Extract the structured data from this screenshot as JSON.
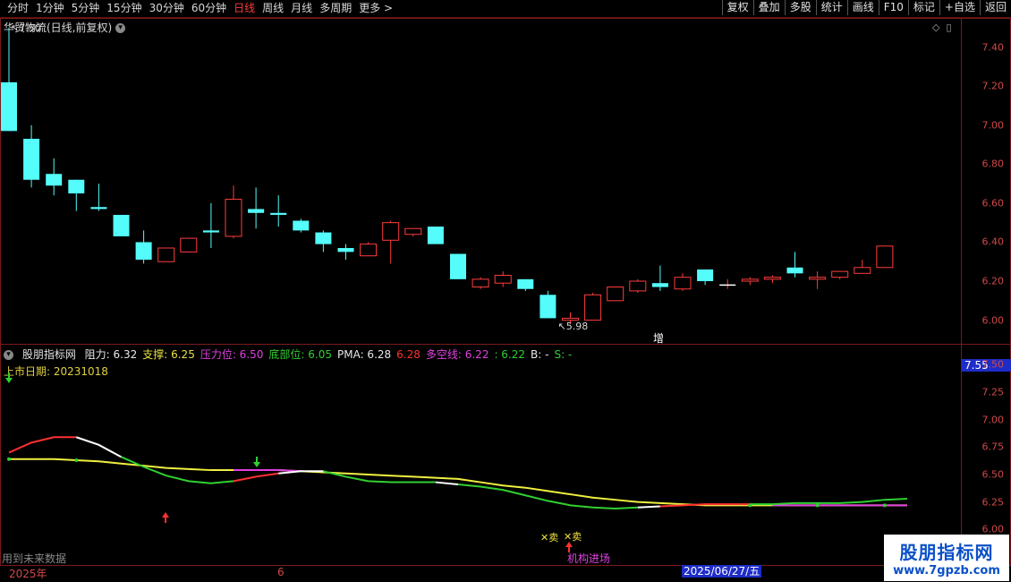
{
  "toolbar": {
    "periods": [
      "分时",
      "1分钟",
      "5分钟",
      "15分钟",
      "30分钟",
      "60分钟",
      "日线",
      "周线",
      "月线",
      "多周期",
      "更多 >"
    ],
    "active": "日线",
    "buttons": [
      "复权",
      "叠加",
      "多股",
      "统计",
      "画线",
      "F10",
      "标记",
      "+自选",
      "返回"
    ]
  },
  "stock": {
    "title": "华贸物流(日线,前复权)",
    "high_label": "7.50",
    "low_label": "5.98",
    "marker": "增"
  },
  "price_axis": [
    "7.40",
    "7.20",
    "7.00",
    "6.80",
    "6.60",
    "6.40",
    "6.20",
    "6.00"
  ],
  "indicator": {
    "name": "股朋指标网",
    "items": [
      {
        "text": "阻力: 6.32",
        "color": "#e8e8e8"
      },
      {
        "text": "支撑: 6.25",
        "color": "#e8e040"
      },
      {
        "text": "压力位: 6.50",
        "color": "#e040e0"
      },
      {
        "text": "底部位: 6.05",
        "color": "#30d030"
      },
      {
        "text": "PMA: 6.28",
        "color": "#e8e8e8"
      },
      {
        "text": "6.28",
        "color": "#ff3030"
      },
      {
        "text": "多空线: 6.22",
        "color": "#e040e0"
      },
      {
        "text": ": 6.22",
        "color": "#30d030"
      },
      {
        "text": "B: -",
        "color": "#e8e8e8"
      },
      {
        "text": "S: -",
        "color": "#30d030"
      }
    ],
    "list_date": "上市日期: 20231018",
    "future_text": "用到未来数据",
    "axis_highlight": "7.55",
    "axis": [
      "7.50",
      "7.25",
      "7.00",
      "6.75",
      "6.50",
      "6.25",
      "6.00"
    ],
    "sell_label": "卖",
    "inst_label": "机构进场"
  },
  "dates": {
    "year": "2025年",
    "month": "6",
    "highlight": "2025/06/27/五"
  },
  "watermark": {
    "title": "股朋指标网",
    "url": "www.7gpzb.com"
  },
  "chart_data": {
    "type": "candlestick",
    "title": "华贸物流(日线,前复权)",
    "candles": [
      {
        "o": 7.22,
        "h": 7.5,
        "l": 6.97,
        "c": 6.97
      },
      {
        "o": 6.93,
        "h": 7.0,
        "l": 6.68,
        "c": 6.72
      },
      {
        "o": 6.75,
        "h": 6.83,
        "l": 6.64,
        "c": 6.69
      },
      {
        "o": 6.72,
        "h": 6.72,
        "l": 6.56,
        "c": 6.65
      },
      {
        "o": 6.58,
        "h": 6.7,
        "l": 6.56,
        "c": 6.57
      },
      {
        "o": 6.54,
        "h": 6.54,
        "l": 6.43,
        "c": 6.43
      },
      {
        "o": 6.4,
        "h": 6.46,
        "l": 6.29,
        "c": 6.31
      },
      {
        "o": 6.3,
        "h": 6.37,
        "l": 6.3,
        "c": 6.37
      },
      {
        "o": 6.35,
        "h": 6.42,
        "l": 6.35,
        "c": 6.42
      },
      {
        "o": 6.46,
        "h": 6.6,
        "l": 6.37,
        "c": 6.45
      },
      {
        "o": 6.43,
        "h": 6.69,
        "l": 6.42,
        "c": 6.62
      },
      {
        "o": 6.57,
        "h": 6.68,
        "l": 6.47,
        "c": 6.55
      },
      {
        "o": 6.55,
        "h": 6.64,
        "l": 6.48,
        "c": 6.54
      },
      {
        "o": 6.51,
        "h": 6.52,
        "l": 6.45,
        "c": 6.46
      },
      {
        "o": 6.45,
        "h": 6.46,
        "l": 6.35,
        "c": 6.39
      },
      {
        "o": 6.37,
        "h": 6.39,
        "l": 6.31,
        "c": 6.35
      },
      {
        "o": 6.33,
        "h": 6.4,
        "l": 6.33,
        "c": 6.39
      },
      {
        "o": 6.41,
        "h": 6.51,
        "l": 6.29,
        "c": 6.5
      },
      {
        "o": 6.44,
        "h": 6.47,
        "l": 6.43,
        "c": 6.47
      },
      {
        "o": 6.48,
        "h": 6.48,
        "l": 6.4,
        "c": 6.39
      },
      {
        "o": 6.34,
        "h": 6.34,
        "l": 6.21,
        "c": 6.21
      },
      {
        "o": 6.17,
        "h": 6.22,
        "l": 6.16,
        "c": 6.21
      },
      {
        "o": 6.19,
        "h": 6.25,
        "l": 6.17,
        "c": 6.23
      },
      {
        "o": 6.21,
        "h": 6.21,
        "l": 6.15,
        "c": 6.16
      },
      {
        "o": 6.13,
        "h": 6.15,
        "l": 6.01,
        "c": 6.01
      },
      {
        "o": 6.0,
        "h": 6.04,
        "l": 5.98,
        "c": 6.01
      },
      {
        "o": 6.0,
        "h": 6.14,
        "l": 6.0,
        "c": 6.13
      },
      {
        "o": 6.1,
        "h": 6.17,
        "l": 6.1,
        "c": 6.17
      },
      {
        "o": 6.15,
        "h": 6.21,
        "l": 6.14,
        "c": 6.2
      },
      {
        "o": 6.19,
        "h": 6.28,
        "l": 6.15,
        "c": 6.17
      },
      {
        "o": 6.16,
        "h": 6.24,
        "l": 6.15,
        "c": 6.22
      },
      {
        "o": 6.26,
        "h": 6.26,
        "l": 6.18,
        "c": 6.2
      },
      {
        "o": 6.18,
        "h": 6.21,
        "l": 6.16,
        "c": 6.18
      },
      {
        "o": 6.2,
        "h": 6.22,
        "l": 6.18,
        "c": 6.21
      },
      {
        "o": 6.21,
        "h": 6.23,
        "l": 6.19,
        "c": 6.22
      },
      {
        "o": 6.27,
        "h": 6.35,
        "l": 6.22,
        "c": 6.24
      },
      {
        "o": 6.21,
        "h": 6.25,
        "l": 6.16,
        "c": 6.22
      },
      {
        "o": 6.22,
        "h": 6.25,
        "l": 6.21,
        "c": 6.25
      },
      {
        "o": 6.24,
        "h": 6.31,
        "l": 6.24,
        "c": 6.27
      },
      {
        "o": 6.27,
        "h": 6.38,
        "l": 6.27,
        "c": 6.38
      }
    ],
    "indicator_lines": {
      "fast": [
        6.7,
        6.79,
        6.84,
        6.84,
        6.77,
        6.66,
        6.57,
        6.49,
        6.44,
        6.42,
        6.44,
        6.48,
        6.51,
        6.53,
        6.53,
        6.48,
        6.44,
        6.43,
        6.43,
        6.43,
        6.41,
        6.39,
        6.36,
        6.31,
        6.26,
        6.22,
        6.2,
        6.19,
        6.2,
        6.21,
        6.22,
        6.23,
        6.23,
        6.23,
        6.23,
        6.24,
        6.24,
        6.24,
        6.25,
        6.27,
        6.28
      ],
      "slow": [
        6.64,
        6.64,
        6.64,
        6.63,
        6.62,
        6.6,
        6.58,
        6.56,
        6.55,
        6.54,
        6.54,
        6.54,
        6.54,
        6.53,
        6.52,
        6.51,
        6.5,
        6.49,
        6.48,
        6.47,
        6.46,
        6.43,
        6.4,
        6.38,
        6.35,
        6.32,
        6.29,
        6.27,
        6.25,
        6.24,
        6.23,
        6.22,
        6.22,
        6.22,
        6.22,
        6.22,
        6.22,
        6.22,
        6.22,
        6.22,
        6.22
      ]
    }
  }
}
